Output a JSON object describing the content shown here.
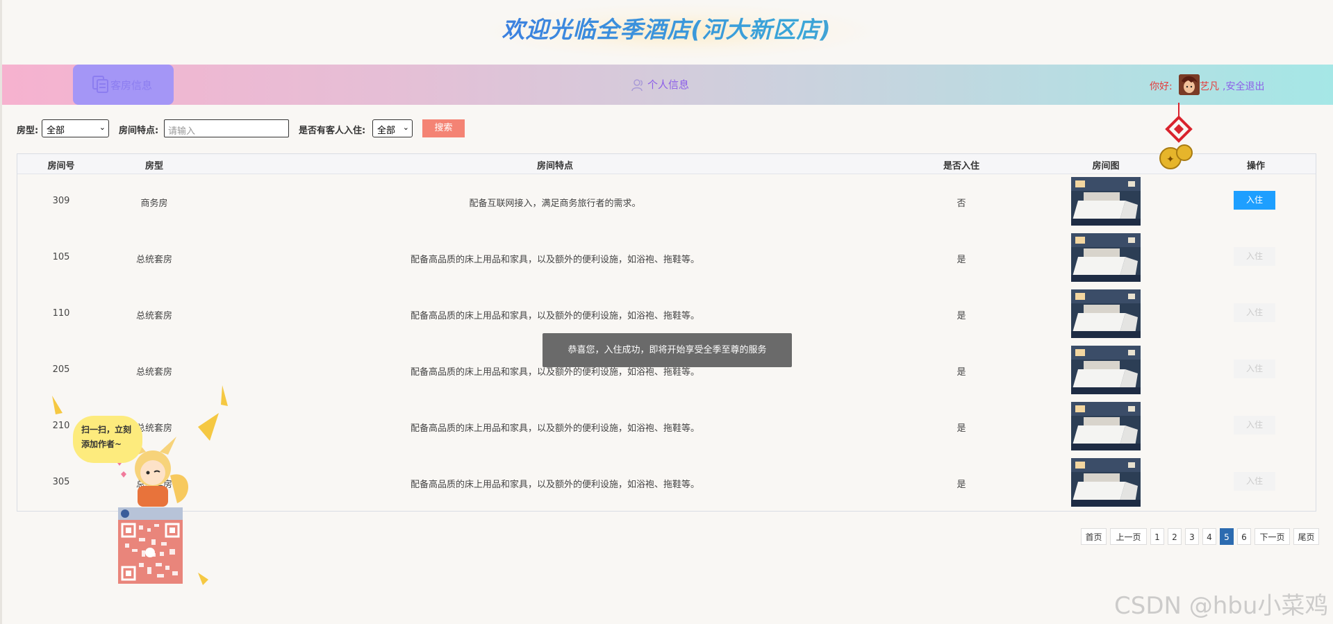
{
  "header": {
    "title": "欢迎光临全季酒店(河大新区店)"
  },
  "nav": {
    "rooms_label": "客房信息",
    "personal_label": "个人信息",
    "greeting": "你好:",
    "username": "艺凡",
    "logout": ",安全退出"
  },
  "filter": {
    "room_type_label": "房型:",
    "room_type_value": "全部",
    "feature_label": "房间特点:",
    "feature_placeholder": "请输入",
    "occupied_label": "是否有客人入住:",
    "occupied_value": "全部",
    "search_button": "搜索"
  },
  "table": {
    "headers": [
      "房间号",
      "房型",
      "房间特点",
      "是否入住",
      "房间图",
      "操作"
    ],
    "rows": [
      {
        "room_no": "309",
        "type": "商务房",
        "feature": "配备互联网接入，满足商务旅行者的需求。",
        "occupied": "否",
        "action": "入住",
        "enabled": true
      },
      {
        "room_no": "105",
        "type": "总统套房",
        "feature": "配备高品质的床上用品和家具，以及额外的便利设施，如浴袍、拖鞋等。",
        "occupied": "是",
        "action": "入住",
        "enabled": false
      },
      {
        "room_no": "110",
        "type": "总统套房",
        "feature": "配备高品质的床上用品和家具，以及额外的便利设施，如浴袍、拖鞋等。",
        "occupied": "是",
        "action": "入住",
        "enabled": false
      },
      {
        "room_no": "205",
        "type": "总统套房",
        "feature": "配备高品质的床上用品和家具，以及额外的便利设施，如浴袍、拖鞋等。",
        "occupied": "是",
        "action": "入住",
        "enabled": false
      },
      {
        "room_no": "210",
        "type": "总统套房",
        "feature": "配备高品质的床上用品和家具，以及额外的便利设施，如浴袍、拖鞋等。",
        "occupied": "是",
        "action": "入住",
        "enabled": false
      },
      {
        "room_no": "305",
        "type": "总统套房",
        "feature": "配备高品质的床上用品和家具，以及额外的便利设施，如浴袍、拖鞋等。",
        "occupied": "是",
        "action": "入住",
        "enabled": false
      }
    ]
  },
  "pagination": {
    "first": "首页",
    "prev": "上一页",
    "pages": [
      "1",
      "2",
      "3",
      "4",
      "5",
      "6"
    ],
    "current": "5",
    "next": "下一页",
    "last": "尾页"
  },
  "toast": "恭喜您，入住成功，即将开始享受全季至尊的服务",
  "promo": {
    "bubble_line1": "扫一扫，立刻",
    "bubble_line2": "添加作者~"
  },
  "watermark": "CSDN @hbu小菜鸡",
  "colors": {
    "accent": "#1e9fff",
    "search": "#f48374",
    "nav_active": "#a496f6",
    "page_active": "#2c6bb0"
  }
}
